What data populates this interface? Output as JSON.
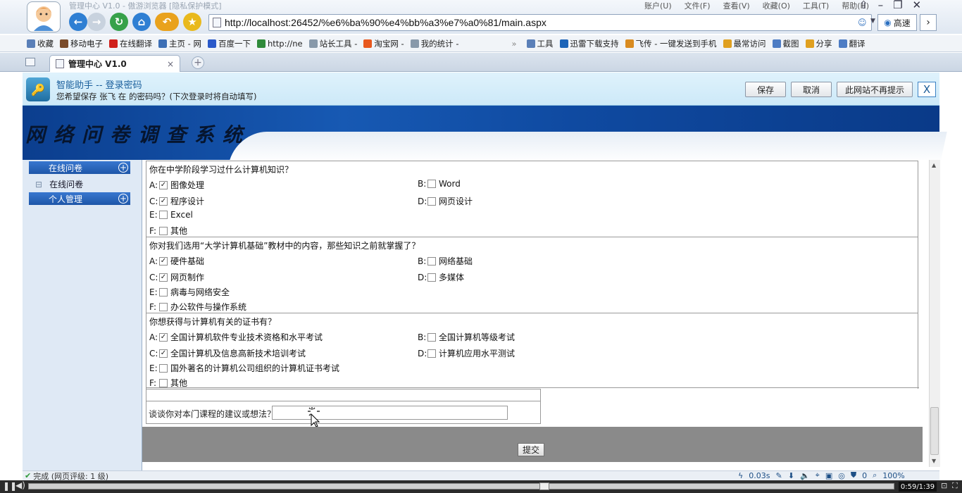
{
  "window": {
    "title": "管理中心 V1.0 - 傲游浏览器 [隐私保护模式]",
    "menu": [
      "账户(U)",
      "文件(F)",
      "查看(V)",
      "收藏(O)",
      "工具(T)",
      "帮助(H)"
    ],
    "url": "http://localhost:26452/%e6%ba%90%e4%bb%a3%e7%a0%81/main.aspx",
    "search_engine": "高速"
  },
  "favorites": [
    {
      "label": "收藏",
      "icon": "star-add-icon",
      "color": "#5a7fb8"
    },
    {
      "label": "移动电子",
      "icon": "mobile-icon",
      "color": "#7a4b2a"
    },
    {
      "label": "在线翻译",
      "icon": "translate-icon",
      "color": "#d0201b"
    },
    {
      "label": "主页 - 网",
      "icon": "home-page-icon",
      "color": "#3d6fb5"
    },
    {
      "label": "百度一下",
      "icon": "baidu-icon",
      "color": "#2a59c9"
    },
    {
      "label": "http://ne",
      "icon": "chart-icon",
      "color": "#2f8a3a"
    },
    {
      "label": "站长工具 -",
      "icon": "page-icon",
      "color": "#8899aa"
    },
    {
      "label": "淘宝网 -",
      "icon": "taobao-icon",
      "color": "#e8581e"
    },
    {
      "label": "我的统计 -",
      "icon": "page-icon",
      "color": "#8899aa"
    },
    {
      "label": "工具",
      "icon": "tools-icon",
      "color": "#5a7fb8"
    },
    {
      "label": "迅雷下载支持",
      "icon": "thunder-icon",
      "color": "#1c64b8"
    },
    {
      "label": "飞传 - 一键发送到手机",
      "icon": "send-icon",
      "color": "#d98b20"
    },
    {
      "label": "最常访问",
      "icon": "frequent-icon",
      "color": "#e0a020"
    },
    {
      "label": "截图",
      "icon": "screenshot-icon",
      "color": "#4d7cc4"
    },
    {
      "label": "分享",
      "icon": "share-icon",
      "color": "#e0a020"
    },
    {
      "label": "翻译",
      "icon": "translate-icon",
      "color": "#4d7cc4"
    }
  ],
  "tab": {
    "title": "管理中心 V1.0"
  },
  "password_helper": {
    "title": "智能助手 -- 登录密码",
    "desc": "您希望保存 张飞 在  的密码吗？(下次登录时将自动填写)",
    "save": "保存",
    "cancel": "取消",
    "never": "此网站不再提示",
    "close": "X"
  },
  "banner": {
    "title": "网络问卷调查系统"
  },
  "sidebar": {
    "section1": "在线问卷",
    "link1": "在线问卷",
    "section2": "个人管理"
  },
  "questions": [
    {
      "title": "你在中学阶段学习过什么计算机知识？",
      "options": [
        {
          "letter": "A:",
          "label": "图像处理",
          "checked": true
        },
        {
          "letter": "B:",
          "label": "Word",
          "checked": false
        },
        {
          "letter": "C:",
          "label": "程序设计",
          "checked": true
        },
        {
          "letter": "D:",
          "label": "网页设计",
          "checked": false
        },
        {
          "letter": "E:",
          "label": "Excel",
          "checked": false
        },
        {
          "letter": "F:",
          "label": "其他",
          "checked": false
        }
      ]
    },
    {
      "title": "你对我们选用“大学计算机基础”教材中的内容，那些知识之前就掌握了？",
      "options": [
        {
          "letter": "A:",
          "label": "硬件基础",
          "checked": true
        },
        {
          "letter": "B:",
          "label": "网络基础",
          "checked": false
        },
        {
          "letter": "C:",
          "label": "网页制作",
          "checked": true
        },
        {
          "letter": "D:",
          "label": "多媒体",
          "checked": false
        },
        {
          "letter": "E:",
          "label": "病毒与网络安全",
          "checked": false
        },
        {
          "letter": "F:",
          "label": "办公软件与操作系统",
          "checked": false
        }
      ]
    },
    {
      "title": "你想获得与计算机有关的证书有？",
      "options": [
        {
          "letter": "A:",
          "label": "全国计算机软件专业技术资格和水平考试",
          "checked": true
        },
        {
          "letter": "B:",
          "label": "全国计算机等级考试",
          "checked": false
        },
        {
          "letter": "C:",
          "label": "全国计算机及信息高新技术培训考试",
          "checked": true
        },
        {
          "letter": "D:",
          "label": "计算机应用水平测试",
          "checked": false
        },
        {
          "letter": "E:",
          "label": "国外著名的计算机公司组织的计算机证书考试",
          "checked": false
        },
        {
          "letter": "F:",
          "label": "其他",
          "checked": false
        }
      ]
    }
  ],
  "suggestion": {
    "label": "谈谈你对本门课程的建议或想法？",
    "value": ""
  },
  "submit": "提交",
  "status": {
    "text": "完成 (网页评级: 1 级)",
    "time": "0.03s",
    "count": "0",
    "zoom": "100%"
  },
  "player": {
    "time": "0:59/1:39",
    "progress": 0.596
  }
}
